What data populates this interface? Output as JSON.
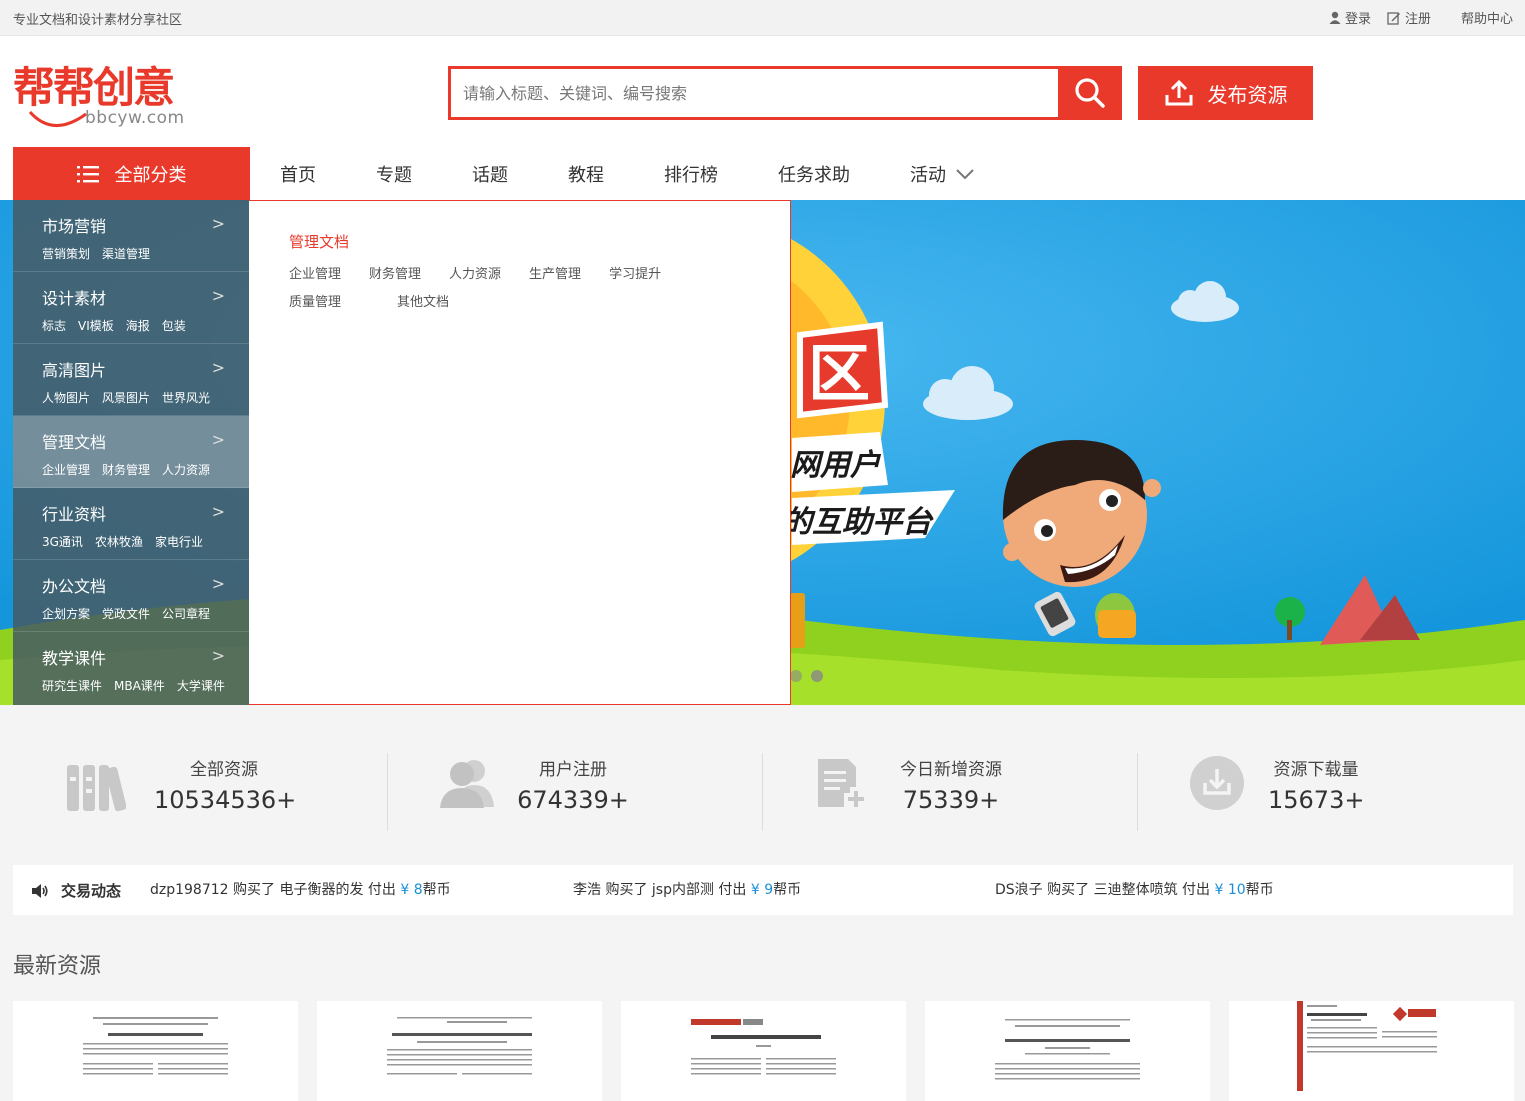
{
  "topbar": {
    "slogan": "专业文档和设计素材分享社区",
    "login": "登录",
    "register": "注册",
    "help": "帮助中心"
  },
  "logo": {
    "cn": "帮帮创意",
    "en": "bbcyw.com"
  },
  "search": {
    "placeholder": "请输入标题、关键词、编号搜索"
  },
  "publish_label": "发布资源",
  "nav": {
    "all_categories": "全部分类",
    "links": [
      "首页",
      "专题",
      "话题",
      "教程",
      "排行榜",
      "任务求助",
      "活动"
    ]
  },
  "sidebar": {
    "items": [
      {
        "title": "市场营销",
        "subs": [
          "营销策划",
          "渠道管理"
        ]
      },
      {
        "title": "设计素材",
        "subs": [
          "标志",
          "VI模板",
          "海报",
          "包装"
        ]
      },
      {
        "title": "高清图片",
        "subs": [
          "人物图片",
          "风景图片",
          "世界风光"
        ]
      },
      {
        "title": "管理文档",
        "subs": [
          "企业管理",
          "财务管理",
          "人力资源"
        ]
      },
      {
        "title": "行业资料",
        "subs": [
          "3G通讯",
          "农林牧渔",
          "家电行业"
        ]
      },
      {
        "title": "办公文档",
        "subs": [
          "企划方案",
          "党政文件",
          "公司章程"
        ]
      },
      {
        "title": "教学课件",
        "subs": [
          "研究生课件",
          "MBA课件",
          "大学课件"
        ]
      }
    ]
  },
  "popup": {
    "title": "管理文档",
    "links": [
      "企业管理",
      "财务管理",
      "人力资源",
      "生产管理",
      "学习提升",
      "质量管理",
      "其他文档"
    ]
  },
  "banner": {
    "text1": "区",
    "text2": "网用户",
    "text3": "的互助平台"
  },
  "stats": [
    {
      "label": "全部资源",
      "value": "10534536+",
      "icon": "books-icon"
    },
    {
      "label": "用户注册",
      "value": "674339+",
      "icon": "users-icon"
    },
    {
      "label": "今日新增资源",
      "value": "75339+",
      "icon": "doc-add-icon"
    },
    {
      "label": "资源下载量",
      "value": "15673+",
      "icon": "download-icon"
    }
  ],
  "ticker": {
    "title": "交易动态",
    "items": [
      {
        "pre": "dzp198712 购买了 电子衡器的发 付出 ",
        "price": "¥ 8",
        "post": "帮币"
      },
      {
        "pre": "李浩 购买了 jsp内部测 付出 ",
        "price": "¥ 9",
        "post": "帮币"
      },
      {
        "pre": "DS浪子 购买了 三迪整体喷筑 付出 ",
        "price": "¥ 10",
        "post": "帮币"
      }
    ]
  },
  "latest_title": "最新资源",
  "colors": {
    "brand": "#e8392b",
    "banner_sky": "#1da1e8",
    "price": "#1a8fd8"
  }
}
